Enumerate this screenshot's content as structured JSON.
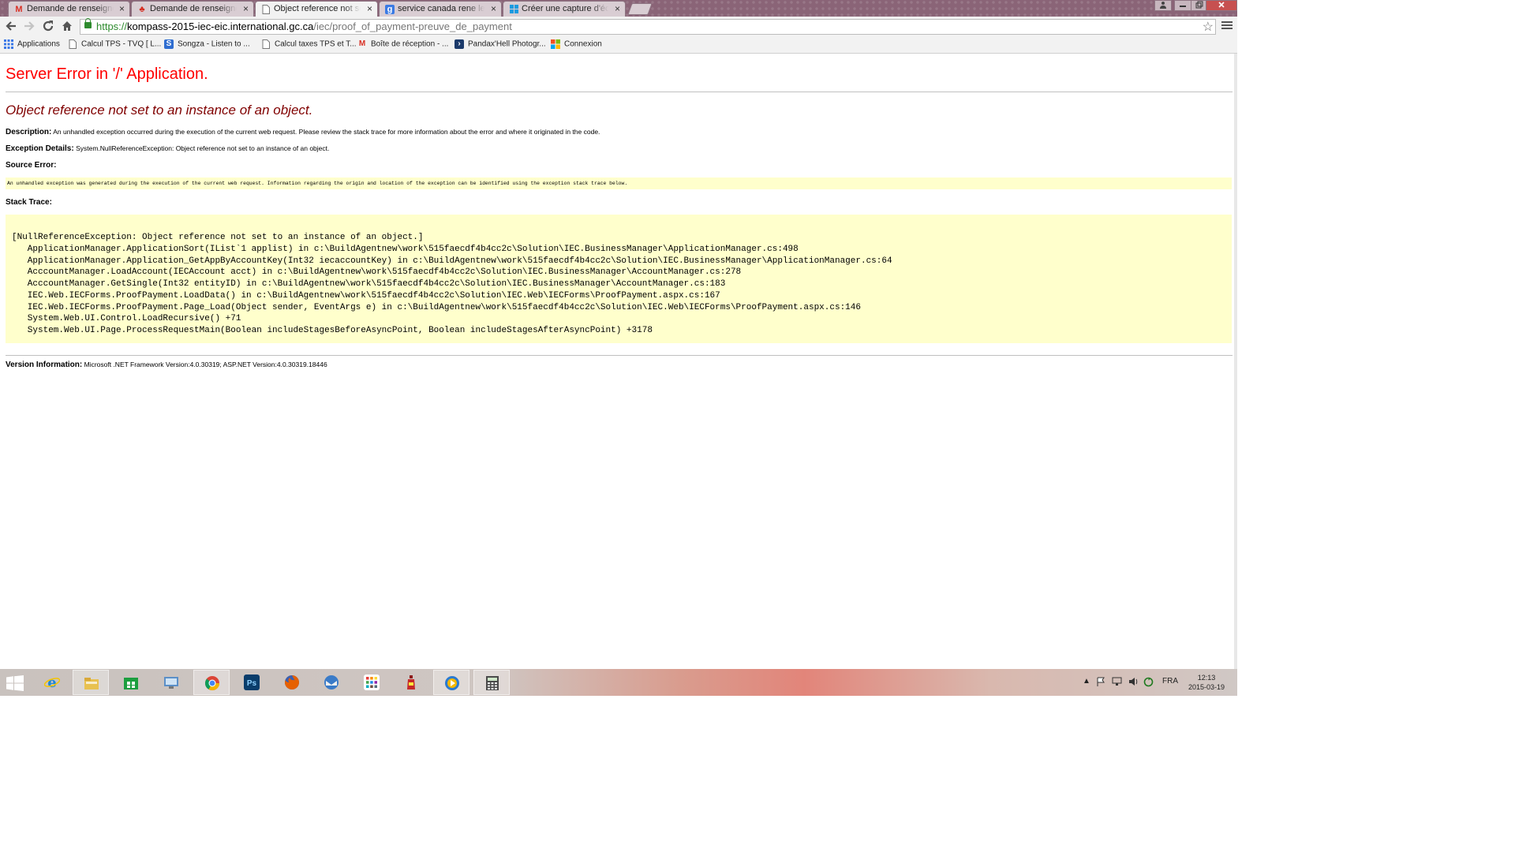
{
  "browser": {
    "tabs": [
      {
        "label": "Demande de renseignements",
        "icon": "gmail-icon",
        "active": false
      },
      {
        "label": "Demande de renseignements",
        "icon": "canada-maple-leaf-icon",
        "active": false
      },
      {
        "label": "Object reference not set to an instance",
        "icon": "page-icon",
        "active": true
      },
      {
        "label": "service canada rene levesque",
        "icon": "google-icon",
        "active": false
      },
      {
        "label": "Créer une capture d'écran",
        "icon": "windows-icon",
        "active": false
      }
    ],
    "close_glyph": "×",
    "url": {
      "scheme": "https://",
      "host": "kompass-2015-iec-eic.international.gc.ca",
      "path": "/iec/proof_of_payment-preuve_de_payment"
    },
    "bookmarks": [
      {
        "label": "Applications",
        "icon": "apps-grid-icon"
      },
      {
        "label": "Calcul TPS - TVQ [ L...",
        "icon": "page-icon"
      },
      {
        "label": "Songza - Listen to ...",
        "icon": "songza-icon"
      },
      {
        "label": "Calcul taxes TPS et T...",
        "icon": "page-icon"
      },
      {
        "label": "Boîte de réception - ...",
        "icon": "gmail-icon"
      },
      {
        "label": "Pandax'Hell Photogr...",
        "icon": "pandax-icon"
      },
      {
        "label": "Connexion",
        "icon": "windows-icon"
      }
    ]
  },
  "error_page": {
    "title": "Server Error in '/' Application.",
    "subtitle": "Object reference not set to an instance of an object.",
    "description_label": "Description:",
    "description_text": "An unhandled exception occurred during the execution of the current web request. Please review the stack trace for more information about the error and where it originated in the code.",
    "exception_label": "Exception Details:",
    "exception_text": "System.NullReferenceException: Object reference not set to an instance of an object.",
    "source_error_label": "Source Error:",
    "source_error_text": "An unhandled exception was generated during the execution of the current web request. Information regarding the origin and location of the exception can be identified using the exception stack trace below.",
    "stack_trace_label": "Stack Trace:",
    "stack_trace": [
      "[NullReferenceException: Object reference not set to an instance of an object.]",
      "   ApplicationManager.ApplicationSort(IList`1 applist) in c:\\BuildAgentnew\\work\\515faecdf4b4cc2c\\Solution\\IEC.BusinessManager\\ApplicationManager.cs:498",
      "   ApplicationManager.Application_GetAppByAccountKey(Int32 iecaccountKey) in c:\\BuildAgentnew\\work\\515faecdf4b4cc2c\\Solution\\IEC.BusinessManager\\ApplicationManager.cs:64",
      "   AcccountManager.LoadAccount(IECAccount acct) in c:\\BuildAgentnew\\work\\515faecdf4b4cc2c\\Solution\\IEC.BusinessManager\\AccountManager.cs:278",
      "   AcccountManager.GetSingle(Int32 entityID) in c:\\BuildAgentnew\\work\\515faecdf4b4cc2c\\Solution\\IEC.BusinessManager\\AccountManager.cs:183",
      "   IEC.Web.IECForms.ProofPayment.LoadData() in c:\\BuildAgentnew\\work\\515faecdf4b4cc2c\\Solution\\IEC.Web\\IECForms\\ProofPayment.aspx.cs:167",
      "   IEC.Web.IECForms.ProofPayment.Page_Load(Object sender, EventArgs e) in c:\\BuildAgentnew\\work\\515faecdf4b4cc2c\\Solution\\IEC.Web\\IECForms\\ProofPayment.aspx.cs:146",
      "   System.Web.UI.Control.LoadRecursive() +71",
      "   System.Web.UI.Page.ProcessRequestMain(Boolean includeStagesBeforeAsyncPoint, Boolean includeStagesAfterAsyncPoint) +3178"
    ],
    "version_label": "Version Information:",
    "version_text": "Microsoft .NET Framework Version:4.0.30319; ASP.NET Version:4.0.30319.18446"
  },
  "taskbar": {
    "apps": [
      {
        "name": "internet-explorer-icon",
        "glyph": "e",
        "color": "#1e88d6"
      },
      {
        "name": "file-explorer-icon",
        "glyph": "",
        "color": "#e8c150"
      },
      {
        "name": "store-icon",
        "glyph": "",
        "color": "#1b9e3e"
      },
      {
        "name": "control-panel-icon",
        "glyph": "",
        "color": "#5b8fc7"
      },
      {
        "name": "chrome-icon",
        "glyph": "",
        "color": "#db4437"
      },
      {
        "name": "photoshop-icon",
        "glyph": "Ps",
        "color": "#0a3d6b"
      },
      {
        "name": "firefox-icon",
        "glyph": "",
        "color": "#e66000"
      },
      {
        "name": "thunderbird-icon",
        "glyph": "",
        "color": "#3a7bc8"
      },
      {
        "name": "apps-grid-icon",
        "glyph": "",
        "color": "#ffffff"
      },
      {
        "name": "red-bottle-icon",
        "glyph": "",
        "color": "#c62828"
      },
      {
        "name": "media-player-icon",
        "glyph": "",
        "color": "#2a7ad1"
      },
      {
        "name": "calculator-icon",
        "glyph": "",
        "color": "#4a4a4a"
      }
    ],
    "language": "FRA",
    "time": "12:13",
    "date": "2015-03-19"
  }
}
